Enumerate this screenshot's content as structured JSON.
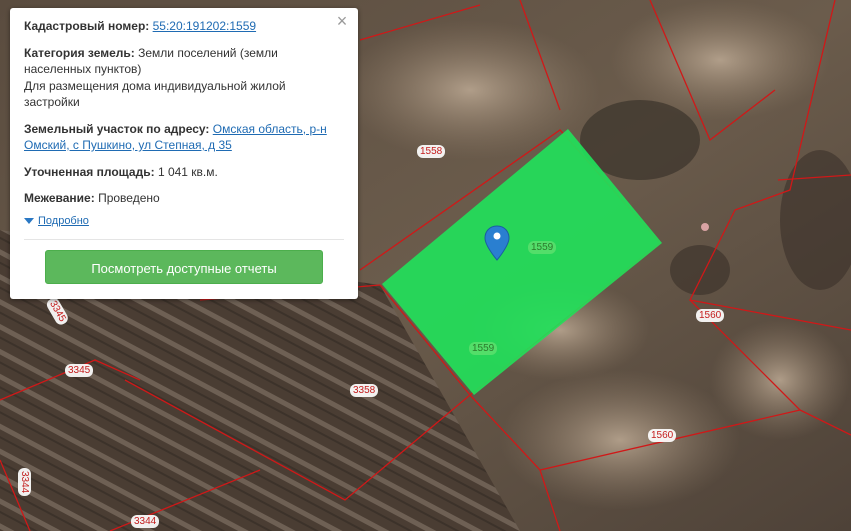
{
  "popup": {
    "cadastral_label": "Кадастровый номер:",
    "cadastral_number": "55:20:191202:1559",
    "category_label": "Категория земель:",
    "category_value": "Земли поселений (земли населенных пунктов)",
    "usage_value": "Для размещения дома индивидуальной жилой застройки",
    "address_label": "Земельный участок по адресу:",
    "address_value": "Омская область, р-н Омский, с Пушкино, ул Степная, д 35",
    "area_label": "Уточненная площадь:",
    "area_value": "1 041 кв.м.",
    "survey_label": "Межевание:",
    "survey_value": "Проведено",
    "details_label": "Подробно",
    "reports_button": "Посмотреть доступные отчеты",
    "close_icon": "×"
  },
  "map": {
    "plot_labels": [
      {
        "id": "l1558",
        "text": "1558"
      },
      {
        "id": "l1559a",
        "text": "1559"
      },
      {
        "id": "l1559b",
        "text": "1559"
      },
      {
        "id": "l1560a",
        "text": "1560"
      },
      {
        "id": "l1560b",
        "text": "1560"
      },
      {
        "id": "l3345a",
        "text": "3345"
      },
      {
        "id": "l3345b",
        "text": "3345"
      },
      {
        "id": "l3358",
        "text": "3358"
      },
      {
        "id": "l3344a",
        "text": "3344"
      },
      {
        "id": "l3344b",
        "text": "3344"
      }
    ],
    "colors": {
      "boundary": "#d01818",
      "selected_fill": "#22e05a",
      "marker": "#2a7fd0"
    }
  }
}
